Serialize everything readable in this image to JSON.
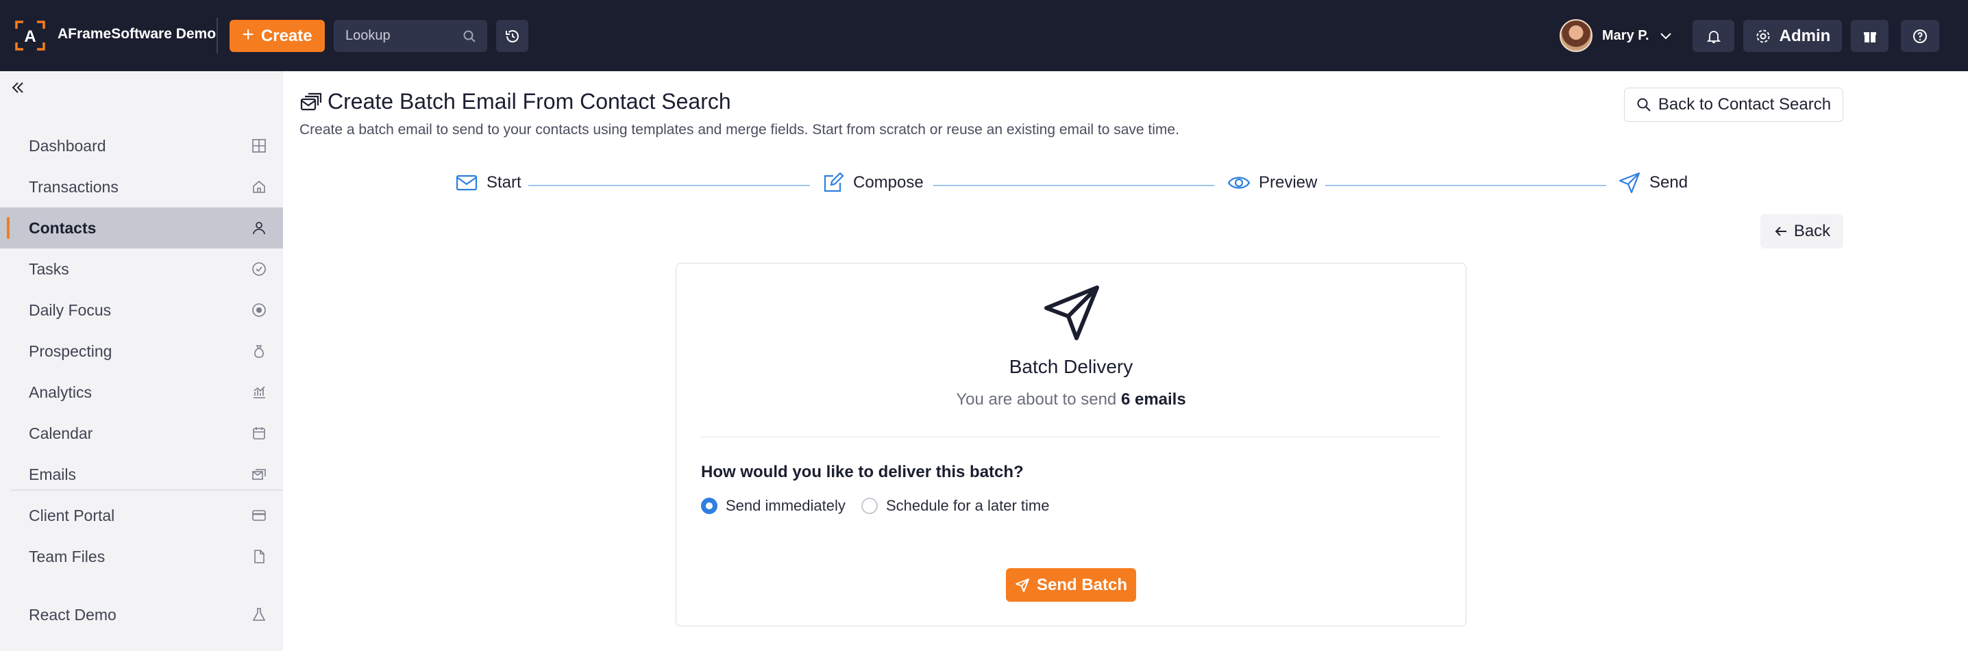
{
  "header": {
    "app_name": "AFrameSoftware Demo",
    "create_label": "Create",
    "lookup_placeholder": "Lookup",
    "user_name": "Mary P.",
    "admin_label": "Admin",
    "accent_color": "#f57c1f",
    "bar_color": "#1b1e2f"
  },
  "sidebar": {
    "items": [
      {
        "label": "Dashboard",
        "icon": "dashboard-icon"
      },
      {
        "label": "Transactions",
        "icon": "home-icon"
      },
      {
        "label": "Contacts",
        "icon": "person-icon",
        "active": true
      },
      {
        "label": "Tasks",
        "icon": "check-circle-icon"
      },
      {
        "label": "Daily Focus",
        "icon": "target-icon"
      },
      {
        "label": "Prospecting",
        "icon": "bag-icon"
      },
      {
        "label": "Analytics",
        "icon": "chart-icon"
      },
      {
        "label": "Calendar",
        "icon": "calendar-icon"
      },
      {
        "label": "Emails",
        "icon": "emails-icon"
      },
      {
        "label": "Client Portal",
        "icon": "card-icon"
      },
      {
        "label": "Team Files",
        "icon": "file-icon"
      }
    ],
    "extra_item": {
      "label": "React Demo",
      "icon": "flask-icon"
    }
  },
  "page": {
    "title": "Create Batch Email From Contact Search",
    "subtitle": "Create a batch email to send to your contacts using templates and merge fields. Start from scratch or reuse an existing email to save time.",
    "back_to_search_label": "Back to Contact Search",
    "back_label": "Back"
  },
  "stepper": {
    "steps": [
      "Start",
      "Compose",
      "Preview",
      "Send"
    ],
    "line_color": "#9cc4ee"
  },
  "delivery": {
    "title": "Batch Delivery",
    "sub_prefix": "You are about to send",
    "sub_count": "6 emails",
    "question": "How would you like to deliver this batch?",
    "options": [
      {
        "label": "Send immediately",
        "selected": true
      },
      {
        "label": "Schedule for a later time",
        "selected": false
      }
    ],
    "send_label": "Send Batch",
    "radio_color": "#2f7fe0"
  }
}
